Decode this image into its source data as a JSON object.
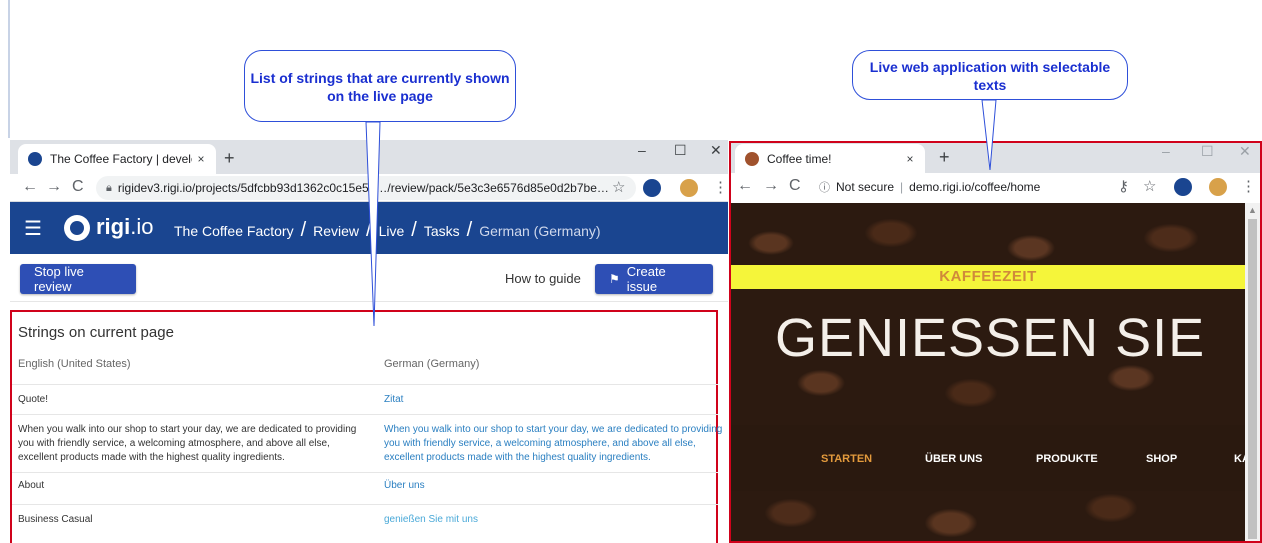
{
  "callouts": {
    "left_text": "List of strings that are currently shown on the live page",
    "right_text": "Live web application with selectable texts"
  },
  "left_browser": {
    "tab_title": "The Coffee Factory | developmen",
    "tab_close": "×",
    "new_tab": "+",
    "window_controls": {
      "minimize": "–",
      "maximize": "☐",
      "close": "✕"
    },
    "url": "rigidev3.rigi.io/projects/5dfcbb93d1362c0c15e5e…/review/pack/5e3c3e6576d85e0d2b7be…",
    "nav_back": "←",
    "nav_forward": "→",
    "nav_reload": "C",
    "star": "☆",
    "menu_dots": "⋮",
    "app": {
      "logo_text": "rigi",
      "logo_suffix": ".io",
      "breadcrumb": [
        "The Coffee Factory",
        "Review",
        "Live",
        "Tasks"
      ],
      "breadcrumb_current": "German (Germany)",
      "slash": "/"
    },
    "toolbar": {
      "stop_button": "Stop live review",
      "how_to": "How to guide",
      "create_issue": "Create issue",
      "flag_icon": "⚑"
    },
    "strings_panel": {
      "title": "Strings on current page",
      "col_source": "English (United States)",
      "col_target": "German (Germany)",
      "rows": [
        {
          "en": "Quote!",
          "de": "Zitat"
        },
        {
          "en": "When you walk into our shop to start your day, we are dedicated to providing you with friendly service, a welcoming atmosphere, and above all else, excellent products made with the highest quality ingredients.",
          "de": "When you walk into our shop to start your day, we are dedicated to providing you with friendly service, a welcoming atmosphere, and above all else, excellent products made with the highest quality ingredients."
        },
        {
          "en": "About",
          "de": "Über uns"
        },
        {
          "en": "Business Casual",
          "de": "genießen Sie mit uns"
        }
      ]
    }
  },
  "right_browser": {
    "tab_title": "Coffee time!",
    "tab_close": "×",
    "new_tab": "+",
    "window_controls": {
      "minimize": "–",
      "maximize": "☐",
      "close": "✕"
    },
    "not_secure": "Not secure",
    "url": "demo.rigi.io/coffee/home",
    "nav_back": "←",
    "nav_forward": "→",
    "nav_reload": "C",
    "info_icon": "ⓘ",
    "key_icon": "⚷",
    "star": "☆",
    "menu_dots": "⋮",
    "site": {
      "banner": "KAFFEEZEIT",
      "headline": "GENIESSEN SIE",
      "nav": [
        "STARTEN",
        "ÜBER UNS",
        "PRODUKTE",
        "SHOP",
        "KA"
      ]
    }
  },
  "colors": {
    "rigi_blue": "#1a4590",
    "button_blue": "#2e4fb5",
    "highlight_red": "#d0021b",
    "callout_blue": "#1a2fd0",
    "banner_yellow": "#f5f53a",
    "nav_active": "#e39a3c"
  }
}
